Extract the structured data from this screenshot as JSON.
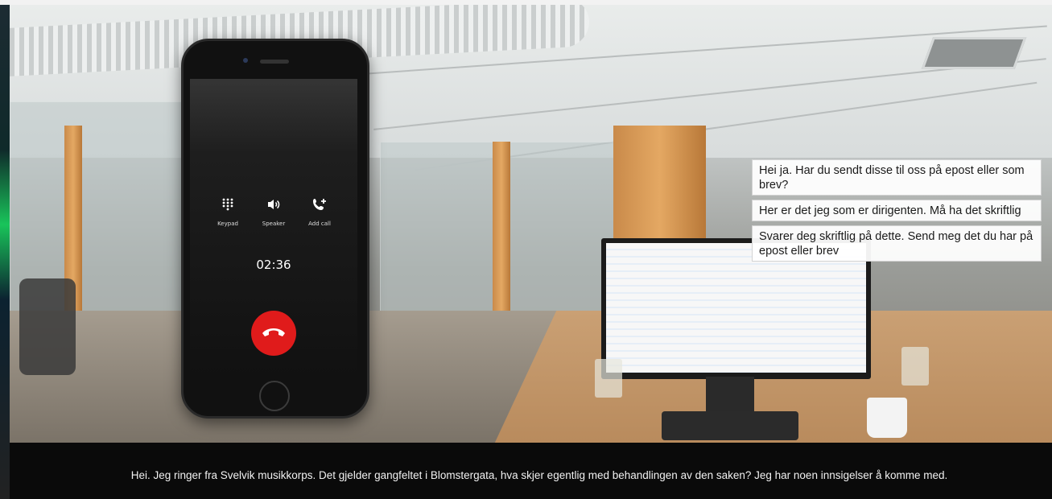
{
  "phone": {
    "actions": [
      {
        "label": "Keypad",
        "icon": "keypad-icon"
      },
      {
        "label": "Speaker",
        "icon": "speaker-icon"
      },
      {
        "label": "Add call",
        "icon": "add-call-icon"
      }
    ],
    "call_timer": "02:36",
    "end_call_color": "#e01b1b"
  },
  "dialogue_options": [
    "Hei ja. Har du sendt disse til oss på epost eller som brev?",
    "Her er det jeg som er dirigenten. Må ha det skriftlig",
    "Svarer deg skriftlig på dette. Send meg det du har på epost eller brev"
  ],
  "subtitle": "Hei. Jeg ringer fra Svelvik musikkorps. Det gjelder gangfeltet i Blomstergata, hva skjer egentlig med behandlingen av den saken? Jeg har noen innsigelser å komme med."
}
